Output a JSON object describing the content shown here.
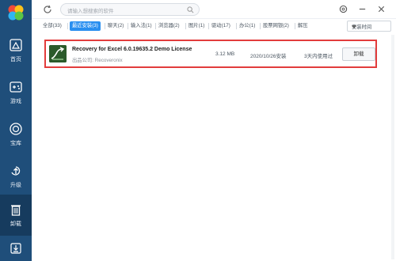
{
  "search": {
    "placeholder": "请输入想搜索的软件"
  },
  "nav": {
    "items": [
      {
        "label": "首页",
        "icon": "home-icon"
      },
      {
        "label": "游戏",
        "icon": "gamepad-icon"
      },
      {
        "label": "宝库",
        "icon": "treasure-icon"
      },
      {
        "label": "升级",
        "icon": "upgrade-icon"
      },
      {
        "label": "卸载",
        "icon": "trash-icon"
      }
    ]
  },
  "tabs": [
    {
      "label": "全部(33)"
    },
    {
      "label": "最近安装(3)"
    },
    {
      "label": "聊天(2)"
    },
    {
      "label": "输入法(1)"
    },
    {
      "label": "浏览器(2)"
    },
    {
      "label": "图片(1)"
    },
    {
      "label": "驱动(17)"
    },
    {
      "label": "办公(1)"
    },
    {
      "label": "股票网银(2)"
    },
    {
      "label": "解压"
    }
  ],
  "sort": {
    "label": "安装时间"
  },
  "apps": [
    {
      "name": "Recovery for Excel 6.0.19635.2 Demo License",
      "publisher": "出品公司: Recoveronix",
      "size": "3.12 MB",
      "install_date": "2020/10/26安装",
      "usage": "3天内使用过",
      "action": "卸载"
    }
  ],
  "colors": {
    "sidebar": "#1f4e7a",
    "accent": "#2a8ff0",
    "highlight": "#e23c3c"
  }
}
